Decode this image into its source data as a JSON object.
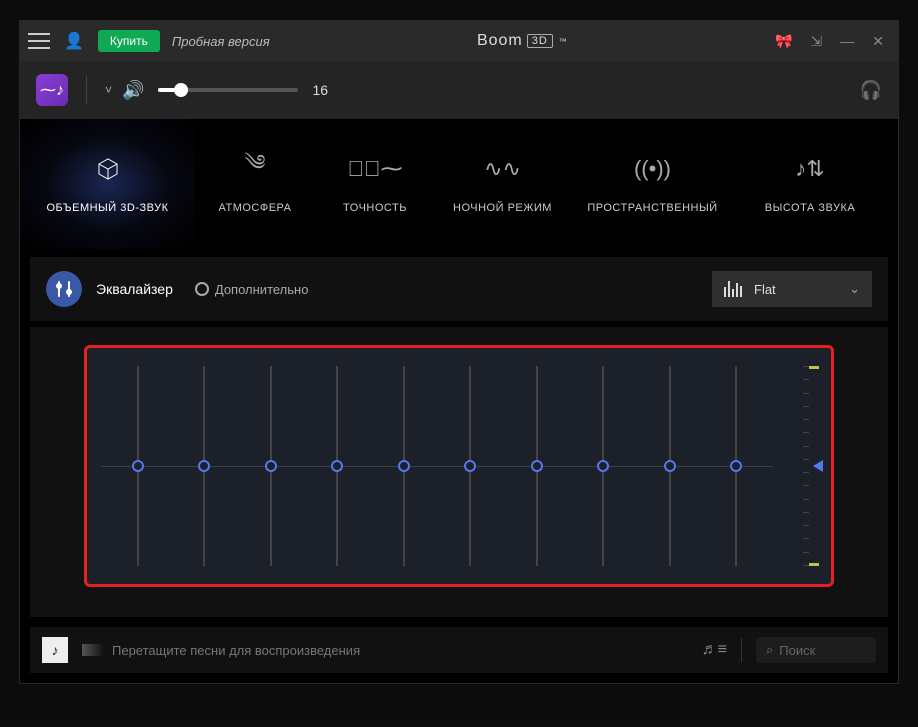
{
  "titlebar": {
    "buy_label": "Купить",
    "trial_label": "Пробная версия",
    "app_name": "Boom",
    "app_badge": "3D",
    "tm": "™"
  },
  "volume": {
    "value": "16"
  },
  "modes": [
    {
      "label": "ОБЪЕМНЫЙ 3D-ЗВУК",
      "icon": "cube",
      "active": true
    },
    {
      "label": "АТМОСФЕРА",
      "icon": "waves",
      "active": false
    },
    {
      "label": "ТОЧНОСТЬ",
      "icon": "pulse",
      "active": false
    },
    {
      "label": "НОЧНОЙ РЕЖИМ",
      "icon": "night",
      "active": false
    },
    {
      "label": "ПРОСТРАНСТВЕННЫЙ",
      "icon": "spread",
      "active": false
    },
    {
      "label": "ВЫСОТА ЗВУКА",
      "icon": "pitch",
      "active": false
    }
  ],
  "eq_header": {
    "eq_label": "Эквалайзер",
    "advanced_label": "Дополнительно",
    "preset_name": "Flat"
  },
  "eq": {
    "bands": [
      0,
      0,
      0,
      0,
      0,
      0,
      0,
      0,
      0,
      0
    ]
  },
  "bottom": {
    "placeholder": "Перетащите песни для воспроизведения",
    "search_placeholder": "Поиск"
  },
  "icons": {
    "waves": "༄",
    "pulse": "⁓ৗ⁓",
    "night": "∿∿",
    "spread": "((•))",
    "pitch": "♪⇅",
    "headphones": "🎧",
    "speaker": "🔊",
    "note": "♫",
    "playlist": "♬≡",
    "search": "⌕",
    "logo": "⁓♪",
    "album": "♪",
    "chev_down": "⌄",
    "chev_small": "˅",
    "user": "👤",
    "gift": "🎀",
    "shrink": "⇲",
    "min": "—",
    "close": "✕"
  }
}
